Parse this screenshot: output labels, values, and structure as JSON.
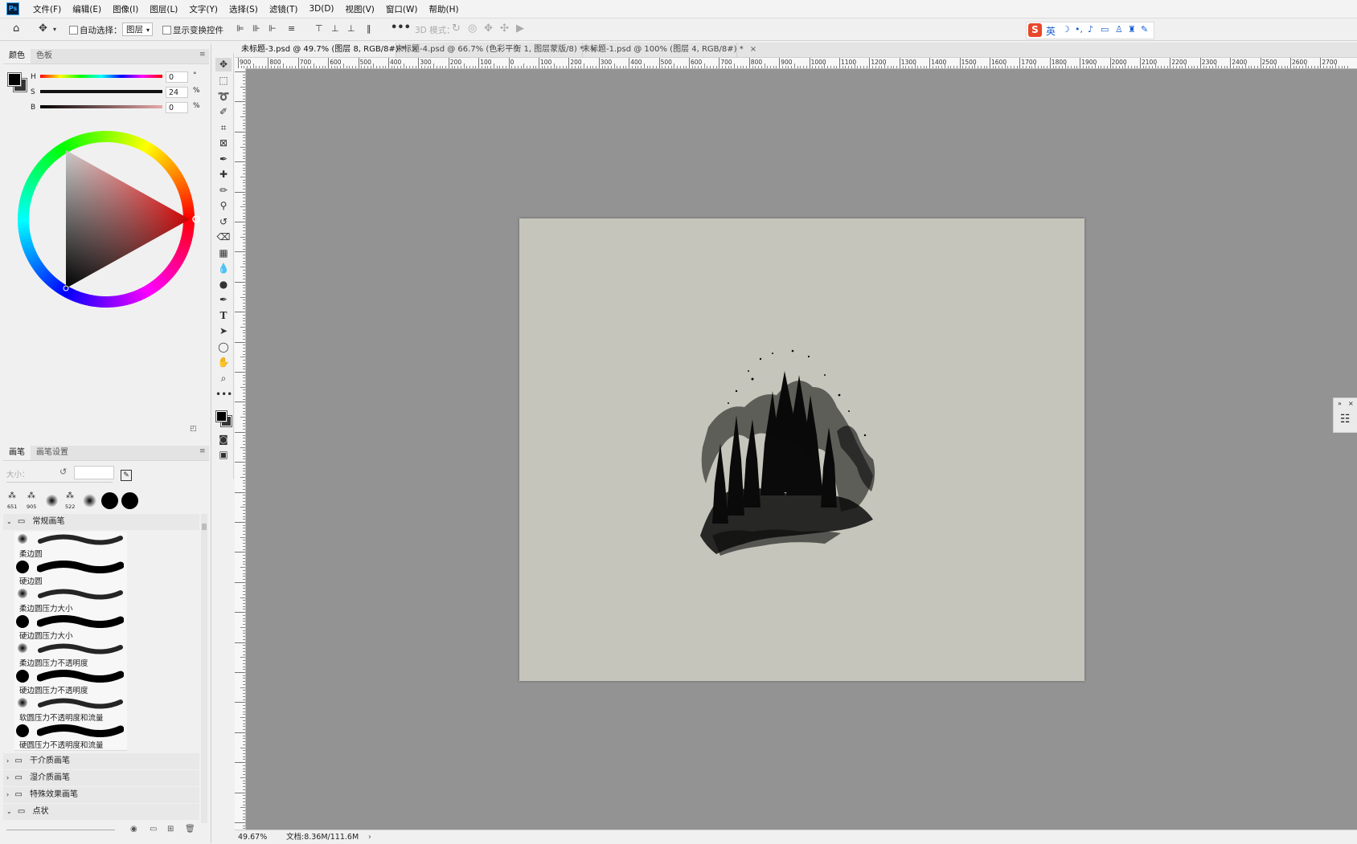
{
  "app": {
    "logo": "Ps"
  },
  "menu": [
    "文件(F)",
    "编辑(E)",
    "图像(I)",
    "图层(L)",
    "文字(Y)",
    "选择(S)",
    "滤镜(T)",
    "3D(D)",
    "视图(V)",
    "窗口(W)",
    "帮助(H)"
  ],
  "options": {
    "auto_select_label": "自动选择：",
    "layer_select": "图层",
    "show_transform_label": "显示变换控件",
    "mode_3d_label": "3D 模式："
  },
  "color_panel": {
    "tabs": [
      "颜色",
      "色板"
    ],
    "h_label": "H",
    "h_value": "0",
    "h_unit": "°",
    "s_label": "S",
    "s_value": "24",
    "s_unit": "%",
    "b_label": "B",
    "b_value": "0",
    "b_unit": "%"
  },
  "brush_panel": {
    "tabs": [
      "画笔",
      "画笔设置"
    ],
    "size_label": "大小：",
    "presets": [
      {
        "num": "651"
      },
      {
        "num": "905"
      },
      {
        "num": ""
      },
      {
        "num": "522"
      },
      {
        "num": ""
      },
      {
        "num": ""
      },
      {
        "num": ""
      }
    ],
    "group_open": "常规画笔",
    "brushes": [
      "柔边圆",
      "硬边圆",
      "柔边圆压力大小",
      "硬边圆压力大小",
      "柔边圆压力不透明度",
      "硬边圆压力不透明度",
      "软圆压力不透明度和流量",
      "硬圆压力不透明度和流量"
    ],
    "groups": [
      "干介质画笔",
      "湿介质画笔",
      "特殊效果画笔",
      "点状"
    ]
  },
  "doc_tabs": [
    {
      "label": "未标题-3.psd @ 49.7% (图层 8, RGB/8#) *",
      "active": true
    },
    {
      "label": "未标题-4.psd @ 66.7% (色彩平衡 1, 图层蒙版/8) *",
      "active": false
    },
    {
      "label": "未标题-1.psd @ 100% (图层 4, RGB/8#) *",
      "active": false
    }
  ],
  "ruler_h": [
    "900",
    "800",
    "700",
    "600",
    "500",
    "400",
    "300",
    "200",
    "100",
    "0",
    "100",
    "200",
    "300",
    "400",
    "500",
    "600",
    "700",
    "800",
    "900",
    "1000",
    "1100",
    "1200",
    "1300",
    "1400",
    "1500",
    "1600",
    "1700",
    "1800",
    "1900",
    "2000",
    "2100",
    "2200",
    "2300",
    "2400",
    "2500",
    "2600",
    "2700"
  ],
  "status": {
    "zoom": "49.67%",
    "doc": "文档:8.36M/111.6M"
  },
  "colors": {
    "canvas": "#c5c5bb",
    "workspace": "#939393",
    "accent": "#31a8ff"
  }
}
